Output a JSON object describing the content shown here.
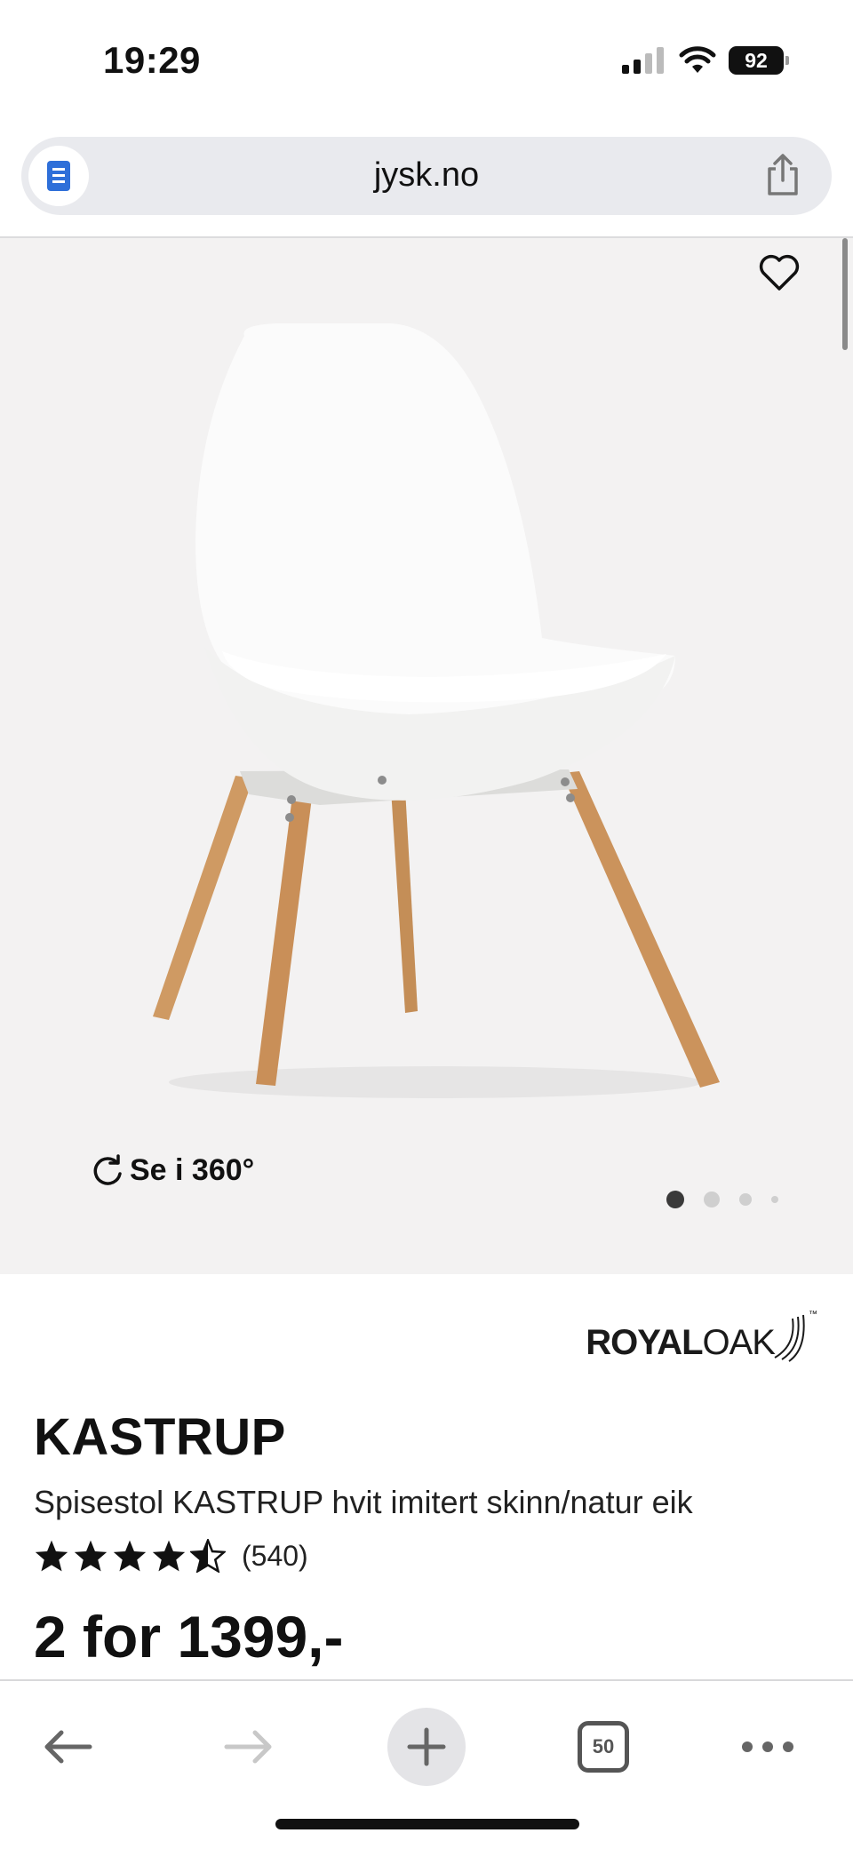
{
  "status": {
    "time": "19:29",
    "battery": "92"
  },
  "browser": {
    "url": "jysk.no",
    "tabs_count": "50"
  },
  "gallery": {
    "rotate_label": "Se i 360°",
    "dots": 4,
    "active_dot": 0
  },
  "product": {
    "brand_part1": "ROYAL",
    "brand_part2": "OAK",
    "brand_tm": "™",
    "name": "KASTRUP",
    "description": "Spisestol KASTRUP hvit imitert skinn/natur eik",
    "rating": 4.5,
    "review_count": "(540)",
    "price": "2 for 1399,-"
  },
  "icons": {
    "reader": "reader-icon",
    "share": "share-icon",
    "favorite": "heart-icon",
    "rotate": "rotate-icon",
    "back": "back-arrow-icon",
    "forward": "forward-arrow-icon",
    "new_tab": "plus-icon",
    "more": "more-icon"
  },
  "colors": {
    "gallery_bg": "#f3f2f2",
    "url_bar_bg": "#e9eaee",
    "accent_blue": "#2e6fd9"
  }
}
